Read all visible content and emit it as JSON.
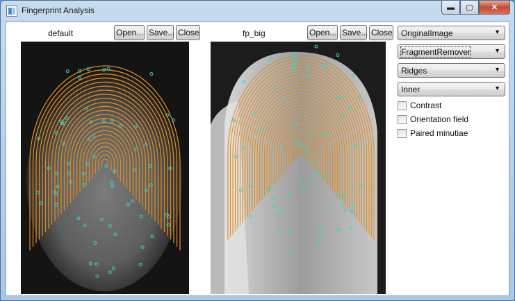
{
  "window": {
    "title": "Fingerprint Analysis",
    "minimize_glyph": "▬",
    "maximize_glyph": "▢",
    "close_glyph": "✕"
  },
  "left_panel": {
    "name": "default",
    "open_label": "Open...",
    "save_label": "Save...",
    "close_label": "Close"
  },
  "right_panel": {
    "name": "fp_big",
    "open_label": "Open...",
    "save_label": "Save...",
    "close_label": "Close"
  },
  "controls": {
    "image_mode": "OriginalImage",
    "filter": "FragmentRemover",
    "skeleton": "Ridges",
    "region": "Inner",
    "dropdown_arrow": "▼",
    "checkboxes": [
      {
        "label": "Contrast",
        "checked": false
      },
      {
        "label": "Orientation field",
        "checked": false
      },
      {
        "label": "Paired minutiae",
        "checked": false
      }
    ]
  },
  "colors": {
    "ridge_overlay": "#e08a1e",
    "minutiae": "#3fd2c0",
    "accent": "#4a8ad0"
  }
}
